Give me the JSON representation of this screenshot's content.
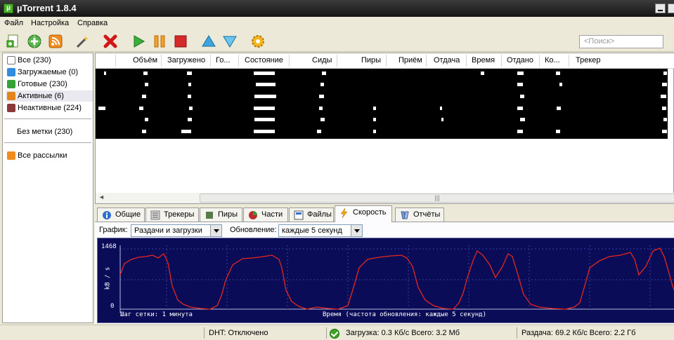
{
  "window": {
    "title": "µTorrent 1.8.4"
  },
  "menu": [
    "Файл",
    "Настройка",
    "Справка"
  ],
  "search": {
    "placeholder": "<Поиск>"
  },
  "sidebar": {
    "items": [
      {
        "label": "Все (230)"
      },
      {
        "label": "Загружаемые (0)"
      },
      {
        "label": "Готовые (230)"
      },
      {
        "label": "Активные (6)"
      },
      {
        "label": "Неактивные (224)"
      }
    ],
    "labels": "Без метки (230)",
    "feeds": "Все рассылки"
  },
  "columns": [
    "Объём",
    "Загружено",
    "Го...",
    "Состояние",
    "Сиды",
    "Пиры",
    "Приём",
    "Отдача",
    "Время",
    "Отдано",
    "Ко...",
    "Трекер"
  ],
  "tabs": [
    "Общие",
    "Трекеры",
    "Пиры",
    "Части",
    "Файлы",
    "Скорость",
    "Отчёты"
  ],
  "speed_panel": {
    "graph_label": "График:",
    "graph_value": "Раздачи и загрузки",
    "update_label": "Обновление:",
    "update_value": "каждые 5 секунд"
  },
  "graph": {
    "ymax_label": "1468",
    "ymin_label": "0",
    "unit": "kB / s",
    "grid_text": "Шаг сетки: 1 минута",
    "time_text": "Время (частота обновления: каждые 5 секунд)"
  },
  "status": {
    "dht": "DHT: Отключено",
    "download": "Загрузка: 0.3 Кб/с  Всего: 3.2 Мб",
    "upload": "Раздача: 69.2 Кб/с  Всего: 2.2 Гб"
  }
}
